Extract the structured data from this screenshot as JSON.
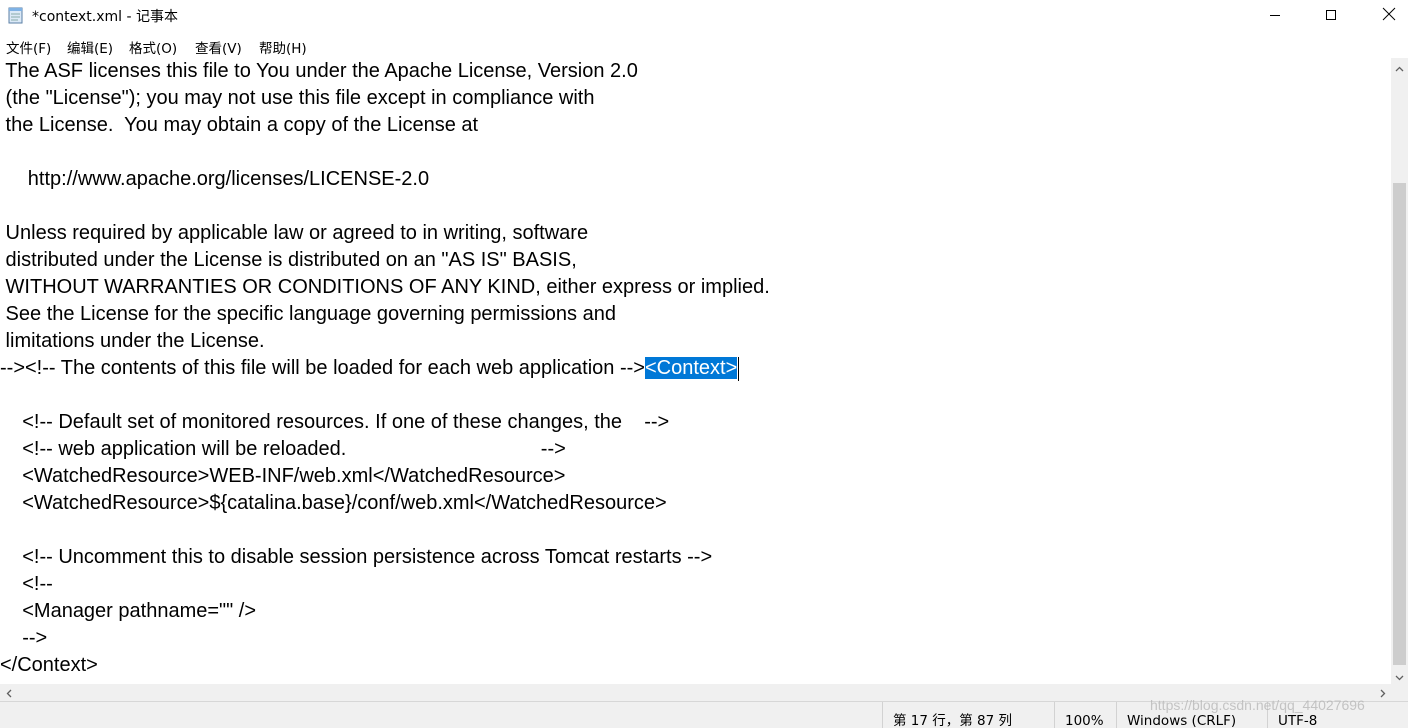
{
  "window": {
    "title": "*context.xml - 记事本",
    "icons": {
      "app": "notepad-icon",
      "minimize": "minimize-icon",
      "maximize": "maximize-icon",
      "close": "close-icon"
    }
  },
  "menu": {
    "items": [
      "文件(F)",
      "编辑(E)",
      "格式(O)",
      "查看(V)",
      "帮助(H)"
    ]
  },
  "editor": {
    "lines": [
      " The ASF licenses this file to You under the Apache License, Version 2.0",
      " (the \"License\"); you may not use this file except in compliance with",
      " the License.  You may obtain a copy of the License at",
      "",
      "     http://www.apache.org/licenses/LICENSE-2.0",
      "",
      " Unless required by applicable law or agreed to in writing, software",
      " distributed under the License is distributed on an \"AS IS\" BASIS,",
      " WITHOUT WARRANTIES OR CONDITIONS OF ANY KIND, either express or implied.",
      " See the License for the specific language governing permissions and",
      " limitations under the License.",
      "",
      "",
      "    <!-- Default set of monitored resources. If one of these changes, the    -->",
      "    <!-- web application will be reloaded.                                   -->",
      "    <WatchedResource>WEB-INF/web.xml</WatchedResource>",
      "    <WatchedResource>${catalina.base}/conf/web.xml</WatchedResource>",
      "",
      "    <!-- Uncomment this to disable session persistence across Tomcat restarts -->",
      "    <!--",
      "    <Manager pathname=\"\" />",
      "    -->",
      "</Context>"
    ],
    "current_line_prefix": "--><!-- The contents of this file will be loaded for each web application -->",
    "selected_text": "<Context>"
  },
  "status": {
    "position": "第 17 行，第 87 列",
    "zoom": "100%",
    "line_ending": "Windows (CRLF)",
    "encoding": "UTF-8"
  },
  "watermark": "https://blog.csdn.net/qq_44027696"
}
